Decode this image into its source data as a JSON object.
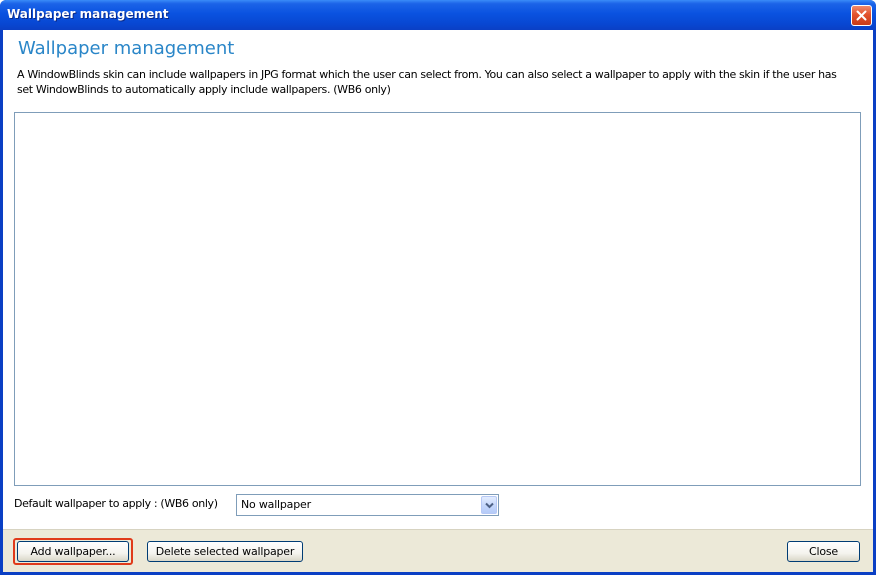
{
  "window": {
    "title": "Wallpaper management"
  },
  "main": {
    "heading": "Wallpaper management",
    "description": "A WindowBlinds skin can include wallpapers in JPG format which the user can select from.  You can also select a wallpaper to apply with the skin if the user has set WindowBlinds to automatically apply include wallpapers. (WB6 only)",
    "wallpaper_list": []
  },
  "default_wallpaper": {
    "label": "Default wallpaper to apply : (WB6 only)",
    "selected": "No wallpaper"
  },
  "footer": {
    "add_label": "Add wallpaper...",
    "delete_label": "Delete selected wallpaper",
    "close_label": "Close"
  },
  "icons": {
    "close": "close-icon",
    "dropdown": "chevron-down-icon"
  },
  "colors": {
    "title_bar": "#0a52e0",
    "heading": "#2a86c8",
    "close_button": "#e2522d",
    "focus_ring": "#e03a1a",
    "footer_bg": "#ece9d8"
  }
}
